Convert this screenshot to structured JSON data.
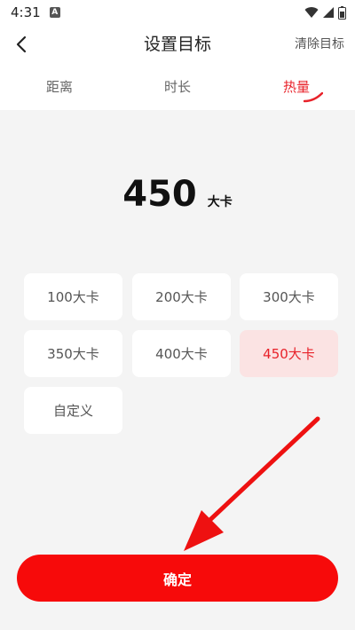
{
  "status_bar": {
    "time": "4:31",
    "notification_letter": "A"
  },
  "header": {
    "title": "设置目标",
    "clear_label": "清除目标"
  },
  "tabs": [
    {
      "label": "距离",
      "active": false
    },
    {
      "label": "时长",
      "active": false
    },
    {
      "label": "热量",
      "active": true
    }
  ],
  "goal": {
    "value": "450",
    "unit": "大卡"
  },
  "options": [
    {
      "label": "100大卡",
      "selected": false
    },
    {
      "label": "200大卡",
      "selected": false
    },
    {
      "label": "300大卡",
      "selected": false
    },
    {
      "label": "350大卡",
      "selected": false
    },
    {
      "label": "400大卡",
      "selected": false
    },
    {
      "label": "450大卡",
      "selected": true
    },
    {
      "label": "自定义",
      "selected": false
    }
  ],
  "confirm_label": "确定",
  "colors": {
    "accent": "#e8222a",
    "button": "#f70a0a",
    "selected_bg": "#fbe3e3",
    "content_bg": "#f4f4f4"
  },
  "icons": {
    "back": "chevron-left-icon",
    "wifi": "wifi-icon",
    "signal": "cell-signal-icon",
    "battery": "battery-icon",
    "arrow": "red-arrow-annotation"
  }
}
